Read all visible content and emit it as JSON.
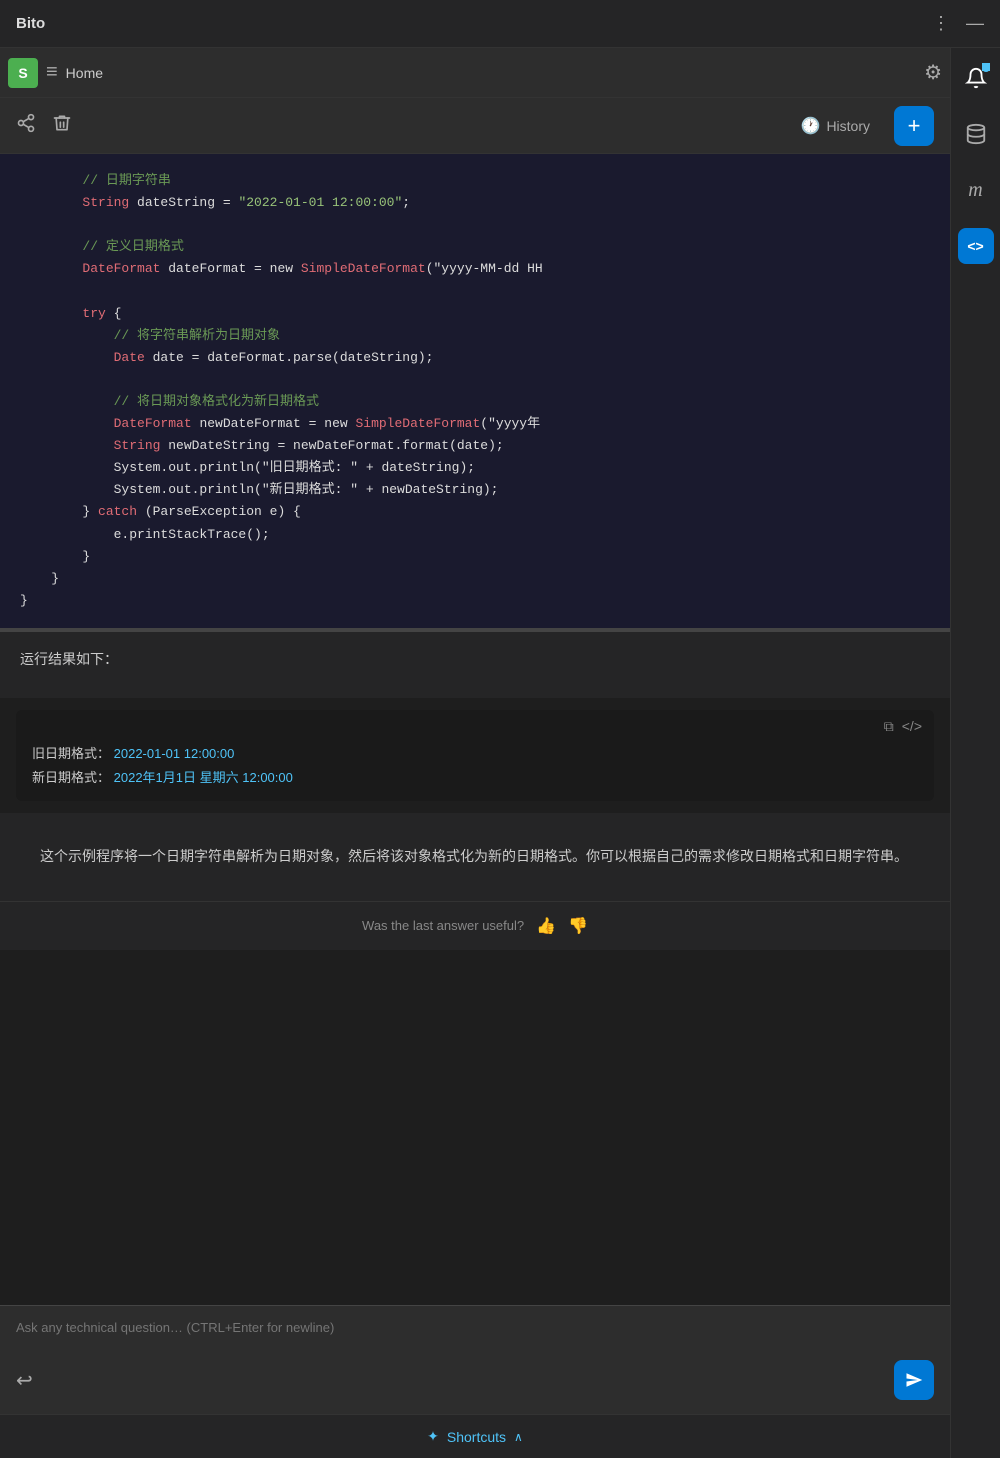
{
  "app": {
    "title": "Bito"
  },
  "titlebar": {
    "more_icon": "⋮",
    "minimize_icon": "—"
  },
  "right_sidebar": {
    "notification_icon": "🔔",
    "db_icon": "🗄",
    "italic_m": "m",
    "code_icon": "<>"
  },
  "tab_bar": {
    "avatar_label": "S",
    "menu_icon": "≡",
    "home_label": "Home",
    "settings_icon": "⚙"
  },
  "toolbar": {
    "share_icon": "share",
    "trash_icon": "trash",
    "history_label": "History",
    "history_icon": "🕐",
    "add_icon": "+"
  },
  "code_block": {
    "lines": [
      {
        "type": "comment",
        "text": "        // 日期字符串"
      },
      {
        "type": "mixed",
        "parts": [
          {
            "cls": "type",
            "t": "        String"
          },
          {
            "cls": "plain",
            "t": " dateString = "
          },
          {
            "cls": "string",
            "t": "\"2022-01-01 12:00:00\""
          },
          {
            "cls": "plain",
            "t": ";"
          }
        ]
      },
      {
        "type": "empty"
      },
      {
        "type": "comment",
        "text": "        // 定义日期格式"
      },
      {
        "type": "mixed",
        "parts": [
          {
            "cls": "type",
            "t": "        DateFormat"
          },
          {
            "cls": "plain",
            "t": " dateFormat = new "
          },
          {
            "cls": "type",
            "t": "SimpleDateFormat"
          },
          {
            "cls": "plain",
            "t": "(\"yyyy-MM-dd HH"
          }
        ]
      },
      {
        "type": "empty"
      },
      {
        "type": "mixed",
        "parts": [
          {
            "cls": "keyword",
            "t": "        try"
          },
          {
            "cls": "plain",
            "t": " {"
          }
        ]
      },
      {
        "type": "comment",
        "text": "            // 将字符串解析为日期对象"
      },
      {
        "type": "mixed",
        "parts": [
          {
            "cls": "type",
            "t": "            Date"
          },
          {
            "cls": "plain",
            "t": " date = dateFormat.parse(dateString);"
          }
        ]
      },
      {
        "type": "empty"
      },
      {
        "type": "comment",
        "text": "            // 将日期对象格式化为新日期格式"
      },
      {
        "type": "mixed",
        "parts": [
          {
            "cls": "type",
            "t": "            DateFormat"
          },
          {
            "cls": "plain",
            "t": " newDateFormat = new "
          },
          {
            "cls": "type",
            "t": "SimpleDateFormat"
          },
          {
            "cls": "plain",
            "t": "(\"yyyy年"
          }
        ]
      },
      {
        "type": "mixed",
        "parts": [
          {
            "cls": "type",
            "t": "            String"
          },
          {
            "cls": "plain",
            "t": " newDateString = newDateFormat.format(date);"
          }
        ]
      },
      {
        "type": "plain",
        "text": "            System.out.println(\"旧日期格式: \" + dateString);"
      },
      {
        "type": "plain",
        "text": "            System.out.println(\"新日期格式: \" + newDateString);"
      },
      {
        "type": "mixed",
        "parts": [
          {
            "cls": "plain",
            "t": "        } "
          },
          {
            "cls": "keyword",
            "t": "catch"
          },
          {
            "cls": "plain",
            "t": " (ParseException e) {"
          }
        ]
      },
      {
        "type": "plain",
        "text": "            e.printStackTrace();"
      },
      {
        "type": "plain",
        "text": "        }"
      },
      {
        "type": "plain",
        "text": "    }"
      },
      {
        "type": "plain",
        "text": "}"
      }
    ]
  },
  "result_label": "运行结果如下：",
  "output_block": {
    "copy_icon": "⧉",
    "code_icon": "</>",
    "line1_label": "旧日期格式：",
    "line1_value": "2022-01-01  12:00:00",
    "line2_label": "新日期格式：",
    "line2_value": "2022年1月1日  星期六  12:00:00"
  },
  "description": "这个示例程序将一个日期字符串解析为日期对象，然后将该对象格式化为新的日期格式。你可以根据自己的需求修改日期格式和日期字符串。",
  "feedback": {
    "label": "Was the last answer useful?",
    "thumbup": "👍",
    "thumbdown": "👎"
  },
  "input": {
    "placeholder": "Ask any technical question… (CTRL+Enter for newline)",
    "undo_icon": "↩",
    "send_icon": "➤"
  },
  "shortcuts": {
    "label": "Shortcuts",
    "icon": "✦",
    "chevron": "∧"
  }
}
